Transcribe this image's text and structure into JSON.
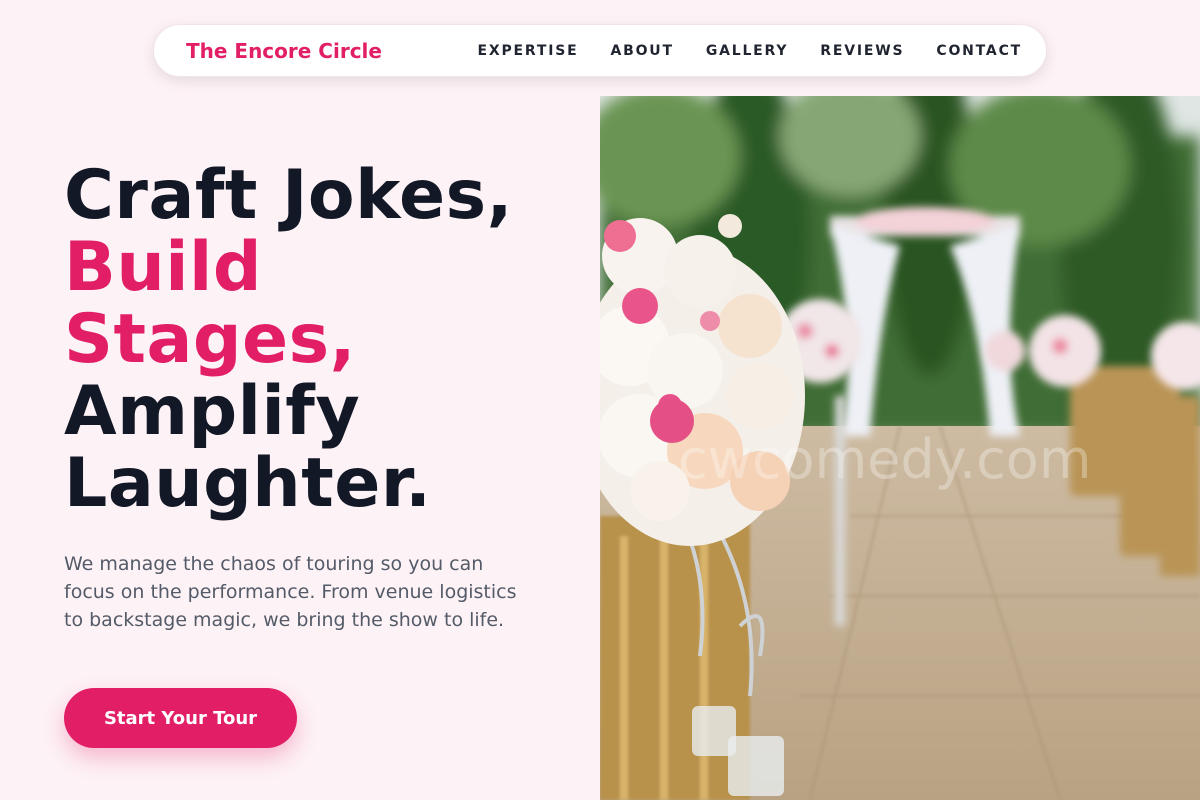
{
  "nav": {
    "brand": "The Encore Circle",
    "links": [
      {
        "label": "EXPERTISE"
      },
      {
        "label": "ABOUT"
      },
      {
        "label": "GALLERY"
      },
      {
        "label": "REVIEWS"
      },
      {
        "label": "CONTACT"
      }
    ]
  },
  "hero": {
    "headline": {
      "line1": "Craft Jokes,",
      "line2": "Build",
      "line3": "Stages,",
      "line4": "Amplify",
      "line5": "Laughter."
    },
    "description": "We manage the chaos of touring so you can focus on the performance. From venue logistics to backstage magic, we bring the show to life.",
    "cta_label": "Start Your Tour",
    "image_watermark": "cwcomedy.com"
  },
  "colors": {
    "accent": "#e21f66",
    "heading": "#121826",
    "background": "#fdf2f6"
  }
}
